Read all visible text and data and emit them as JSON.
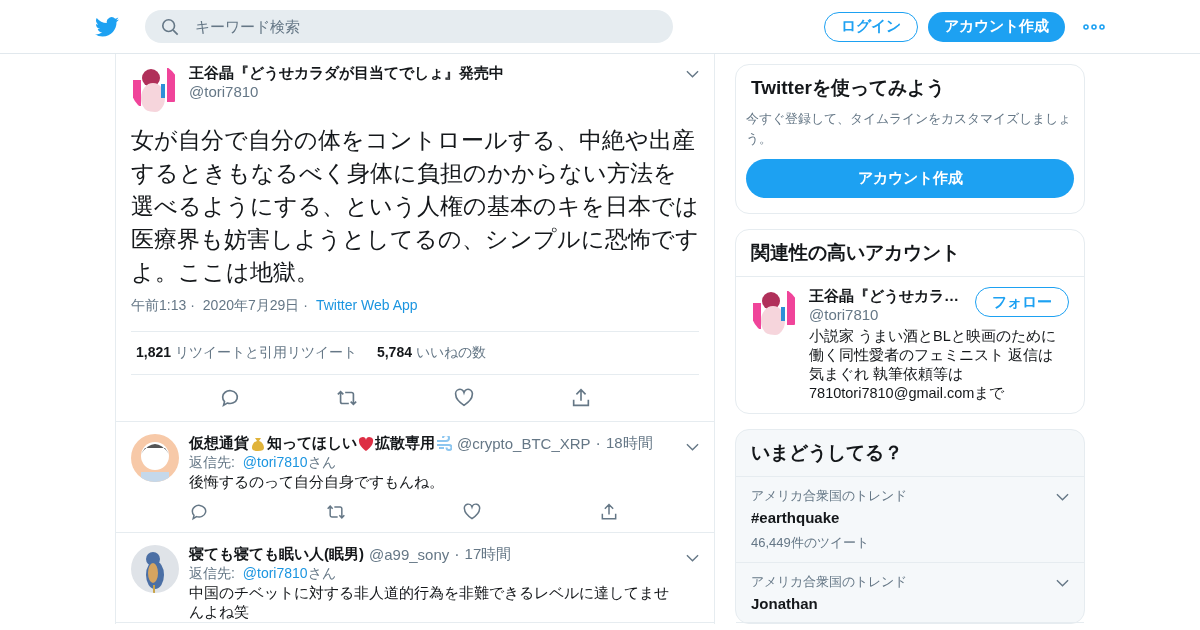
{
  "header": {
    "search": {
      "placeholder": "キーワード検索"
    },
    "login": "ログイン",
    "signup": "アカウント作成"
  },
  "tweet": {
    "name": "王谷晶『どうせカラダが目当てでしょ』発売中",
    "handle": "@tori7810",
    "text": "女が自分で自分の体をコントロールする、中絶や出産するときもなるべく身体に負担のかからない方法を選べるようにする、という人権の基本のキを日本では医療界も妨害しようとしてるの、シンプルに恐怖ですよ。ここは地獄。",
    "time": "午前1:13",
    "separator": "·",
    "date": "2020年7月29日",
    "source": "Twitter Web App",
    "retweets": "1,821",
    "retweets_label": "リツイートと引用リツイート",
    "likes": "5,784",
    "likes_label": "いいねの数"
  },
  "replies": [
    {
      "name_parts": [
        {
          "kind": "text",
          "text": "仮想通貨"
        },
        {
          "kind": "moneybag"
        },
        {
          "kind": "text",
          "text": "知ってほしい"
        },
        {
          "kind": "heart"
        },
        {
          "kind": "text",
          "text": "拡散専用"
        },
        {
          "kind": "dash"
        }
      ],
      "handle": "@crypto_BTC_XRP",
      "separator": "·",
      "age": "18時間",
      "reply_label": "返信先:",
      "reply_to": "@tori7810",
      "reply_suffix": "さん",
      "text": "後悔するのって自分自身ですもんね。",
      "actions": true
    },
    {
      "name_parts": [
        {
          "kind": "text",
          "text": "寝ても寝ても眠い人(眠男)"
        }
      ],
      "handle": "@a99_sony",
      "separator": "·",
      "age": "17時間",
      "reply_label": "返信先:",
      "reply_to": "@tori7810",
      "reply_suffix": "さん",
      "text": "中国のチベットに対する非人道的行為を非難できるレベルに達してませんよね笑",
      "actions": false
    }
  ],
  "signup_card": {
    "title": "Twitterを使ってみよう",
    "text": "今すぐ登録して、タイムラインをカスタマイズしましょう。",
    "button": "アカウント作成"
  },
  "related": {
    "title": "関連性の高いアカウント",
    "name": "王谷晶『どうせカラ…",
    "handle": "@tori7810",
    "follow": "フォロー",
    "bio_lines": [
      "小説家 うまい酒とBLと映画のために",
      "働く同性愛者のフェミニスト 返信は",
      "気まぐれ 執筆依頼等は",
      "7810tori7810@gmail.comまで"
    ]
  },
  "trends": {
    "title": "いまどうしてる？",
    "items": [
      {
        "context": "アメリカ合衆国のトレンド",
        "topic": "#earthquake",
        "count": "46,449件のツイート"
      },
      {
        "context": "アメリカ合衆国のトレンド",
        "topic": "Jonathan"
      }
    ]
  }
}
